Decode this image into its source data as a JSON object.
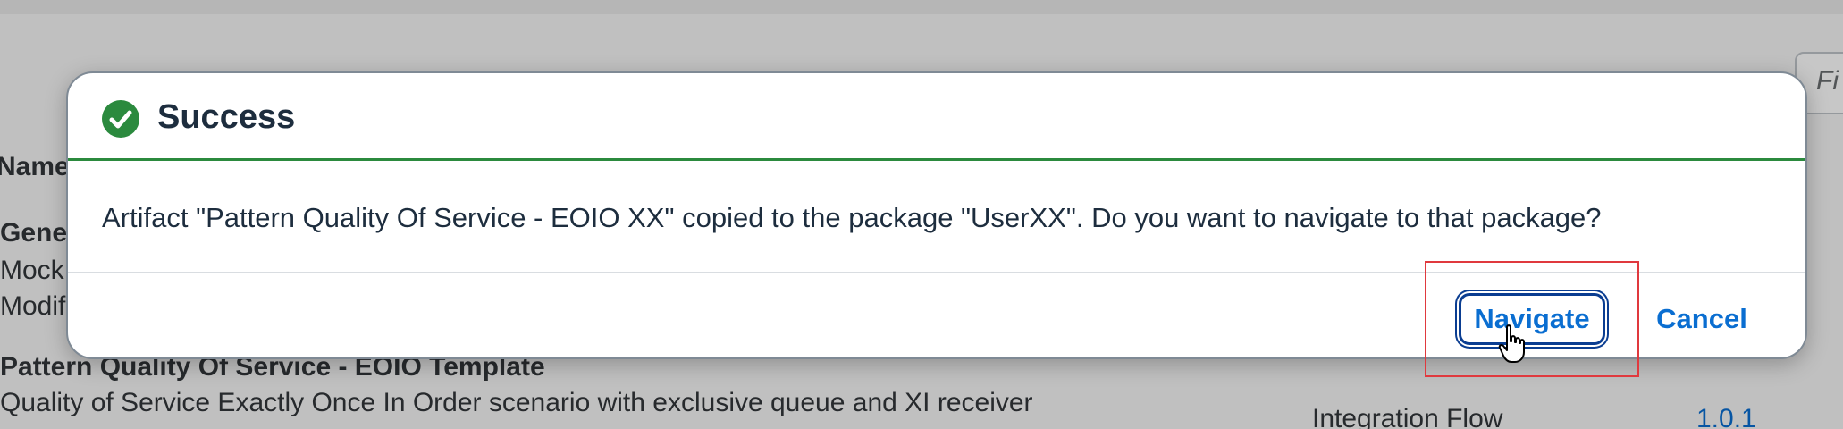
{
  "background": {
    "filter_placeholder": "Fi",
    "column_header": "Name",
    "rows": [
      {
        "title": "Gene",
        "line1": "Mock",
        "line2": "Modif"
      },
      {
        "title": "Pattern Quality Of Service - EOIO Template",
        "description": "Quality of Service Exactly Once In Order scenario with exclusive queue and XI receiver",
        "type": "Integration Flow",
        "version": "1.0.1"
      }
    ]
  },
  "dialog": {
    "title": "Success",
    "icon": "checkmark-circle-icon",
    "message": "Artifact \"Pattern Quality Of Service - EOIO XX\" copied to the package \"UserXX\". Do you want to navigate to that package?",
    "navigate_label": "Navigate",
    "cancel_label": "Cancel"
  },
  "colors": {
    "success": "#2b8a3e",
    "accent": "#0a6ed1",
    "highlight": "#e0393e"
  }
}
